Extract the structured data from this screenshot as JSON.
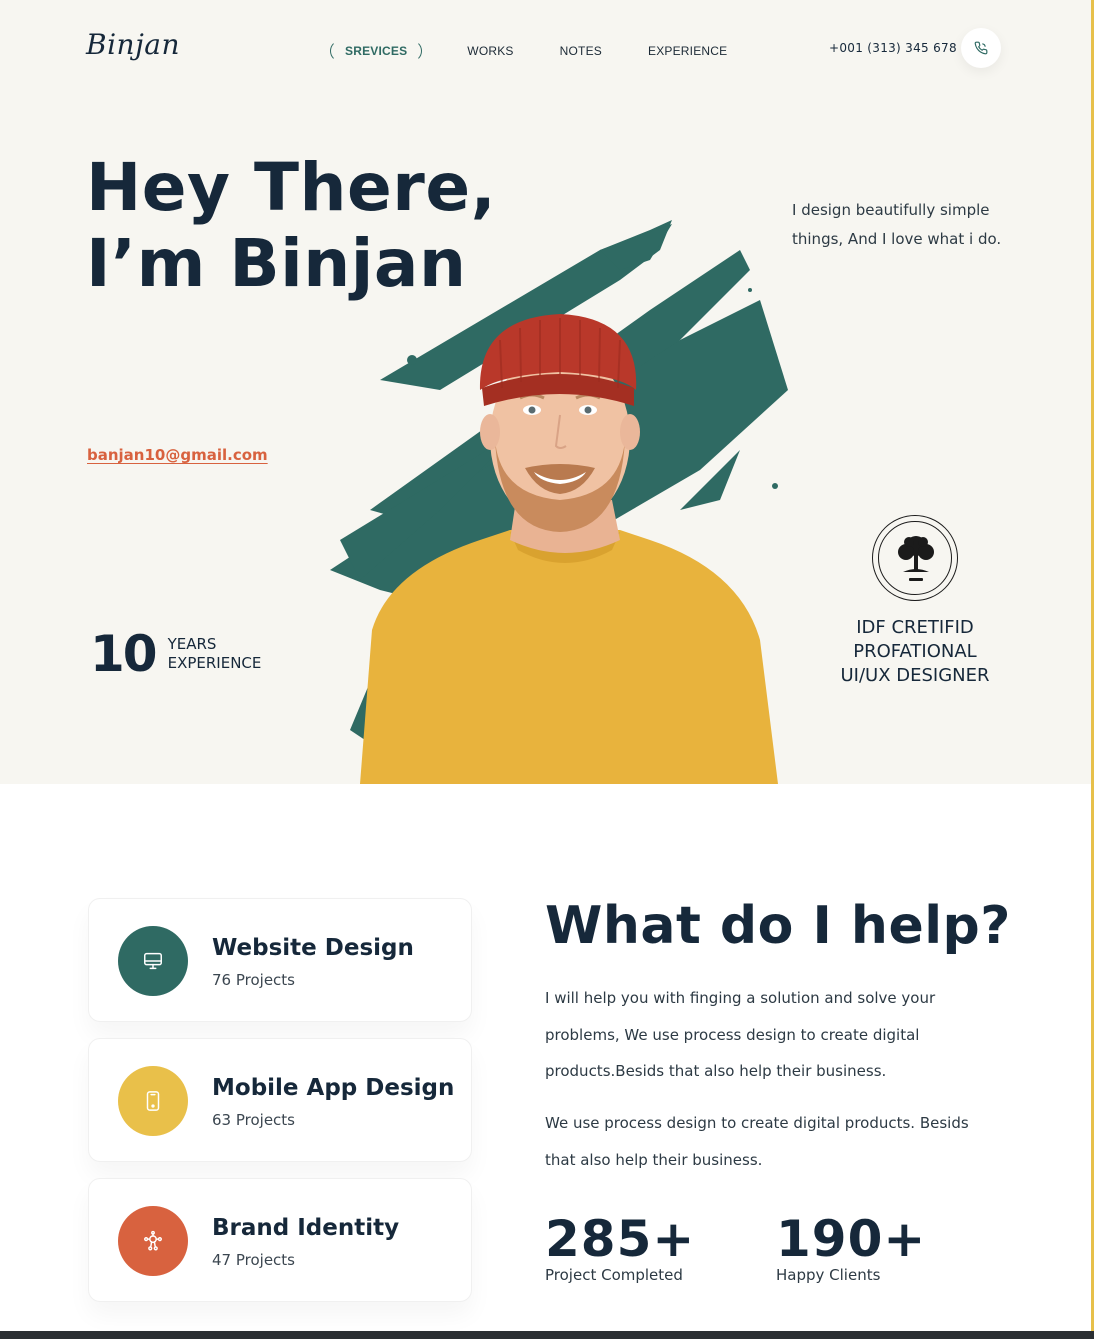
{
  "brand": {
    "logo": "Binjan"
  },
  "nav": {
    "items": [
      {
        "label": "SREVICES",
        "active": true
      },
      {
        "label": "WORKS",
        "active": false
      },
      {
        "label": "NOTES",
        "active": false
      },
      {
        "label": "EXPERIENCE",
        "active": false
      }
    ]
  },
  "contact": {
    "phone": "+001 (313) 345 678",
    "email": "banjan10@gmail.com",
    "phone_icon": "phone-icon"
  },
  "hero": {
    "title_line1": "Hey There,",
    "title_line2": "I’m Binjan",
    "tagline": "I design beautifully simple things, And I love what i do.",
    "years_number": "10",
    "years_line1": "YEARS",
    "years_line2": "EXPERIENCE",
    "cert_line1": "IDF CRETIFID",
    "cert_line2": "PROFATIONAL",
    "cert_line3": "UI/UX DESIGNER"
  },
  "services": [
    {
      "title": "Website Design",
      "projects": "76 Projects",
      "icon": "monitor-icon",
      "color": "#2f6a63"
    },
    {
      "title": "Mobile App Design",
      "projects": "63 Projects",
      "icon": "mobile-icon",
      "color": "#e9c04a"
    },
    {
      "title": "Brand Identity",
      "projects": "47 Projects",
      "icon": "brand-network-icon",
      "color": "#d8623f"
    }
  ],
  "help": {
    "title": "What do I help?",
    "paragraph1": "I will help you with finging a solution and solve your problems, We use process design to create digital products.Besids that also help their business.",
    "paragraph2": "We use process design to create digital products. Besids that also help their business."
  },
  "stats": [
    {
      "value": "285+",
      "label": "Project Completed"
    },
    {
      "value": "190+",
      "label": "Happy Clients"
    }
  ],
  "colors": {
    "accent": "#2f6a63",
    "yellow": "#e9c04a",
    "orange": "#d8623f",
    "ink": "#16283a",
    "hero_bg": "#f7f6f1"
  }
}
